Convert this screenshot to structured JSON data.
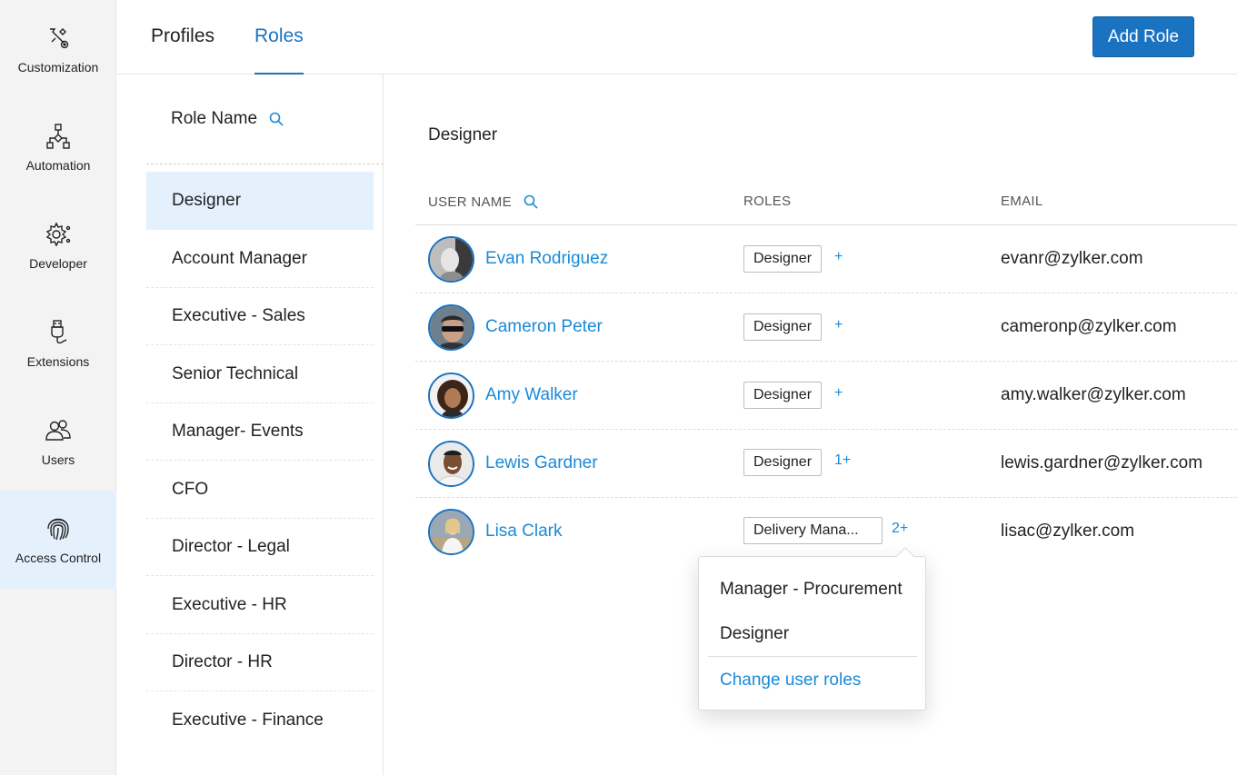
{
  "colors": {
    "accent": "#1a73c1",
    "link": "#1a8ad8",
    "active_bg": "#e4f1fd",
    "rail_bg": "#f3f3f3"
  },
  "rail": {
    "items": [
      {
        "label": "Customization",
        "icon": "customization-icon"
      },
      {
        "label": "Automation",
        "icon": "automation-icon"
      },
      {
        "label": "Developer",
        "icon": "developer-icon"
      },
      {
        "label": "Extensions",
        "icon": "extensions-icon"
      },
      {
        "label": "Users",
        "icon": "users-icon"
      },
      {
        "label": "Access Control",
        "icon": "fingerprint-icon",
        "active": true
      }
    ]
  },
  "header": {
    "tabs": [
      {
        "label": "Profiles"
      },
      {
        "label": "Roles",
        "active": true
      }
    ],
    "add_role_label": "Add Role"
  },
  "roles_list": {
    "header": "Role Name",
    "items": [
      {
        "label": "Designer",
        "active": true
      },
      {
        "label": "Account Manager"
      },
      {
        "label": "Executive - Sales"
      },
      {
        "label": "Senior Technical"
      },
      {
        "label": "Manager- Events"
      },
      {
        "label": "CFO"
      },
      {
        "label": "Director - Legal"
      },
      {
        "label": "Executive - HR"
      },
      {
        "label": "Director - HR"
      },
      {
        "label": "Executive - Finance"
      }
    ]
  },
  "main": {
    "title": "Designer",
    "columns": {
      "user": "USER NAME",
      "roles": "ROLES",
      "email": "EMAIL"
    },
    "users": [
      {
        "name": "Evan Rodriguez",
        "role": "Designer",
        "more": "+",
        "email": "evanr@zylker.com"
      },
      {
        "name": "Cameron Peter",
        "role": "Designer",
        "more": "+",
        "email": "cameronp@zylker.com"
      },
      {
        "name": "Amy Walker",
        "role": "Designer",
        "more": "+",
        "email": "amy.walker@zylker.com"
      },
      {
        "name": "Lewis Gardner",
        "role": "Designer",
        "more": "1+",
        "email": "lewis.gardner@zylker.com"
      },
      {
        "name": "Lisa Clark",
        "role": "Delivery Mana...",
        "more": "2+",
        "email": "lisac@zylker.com"
      }
    ]
  },
  "popover": {
    "items": [
      "Manager - Procurement",
      "Designer"
    ],
    "link": "Change user roles"
  }
}
